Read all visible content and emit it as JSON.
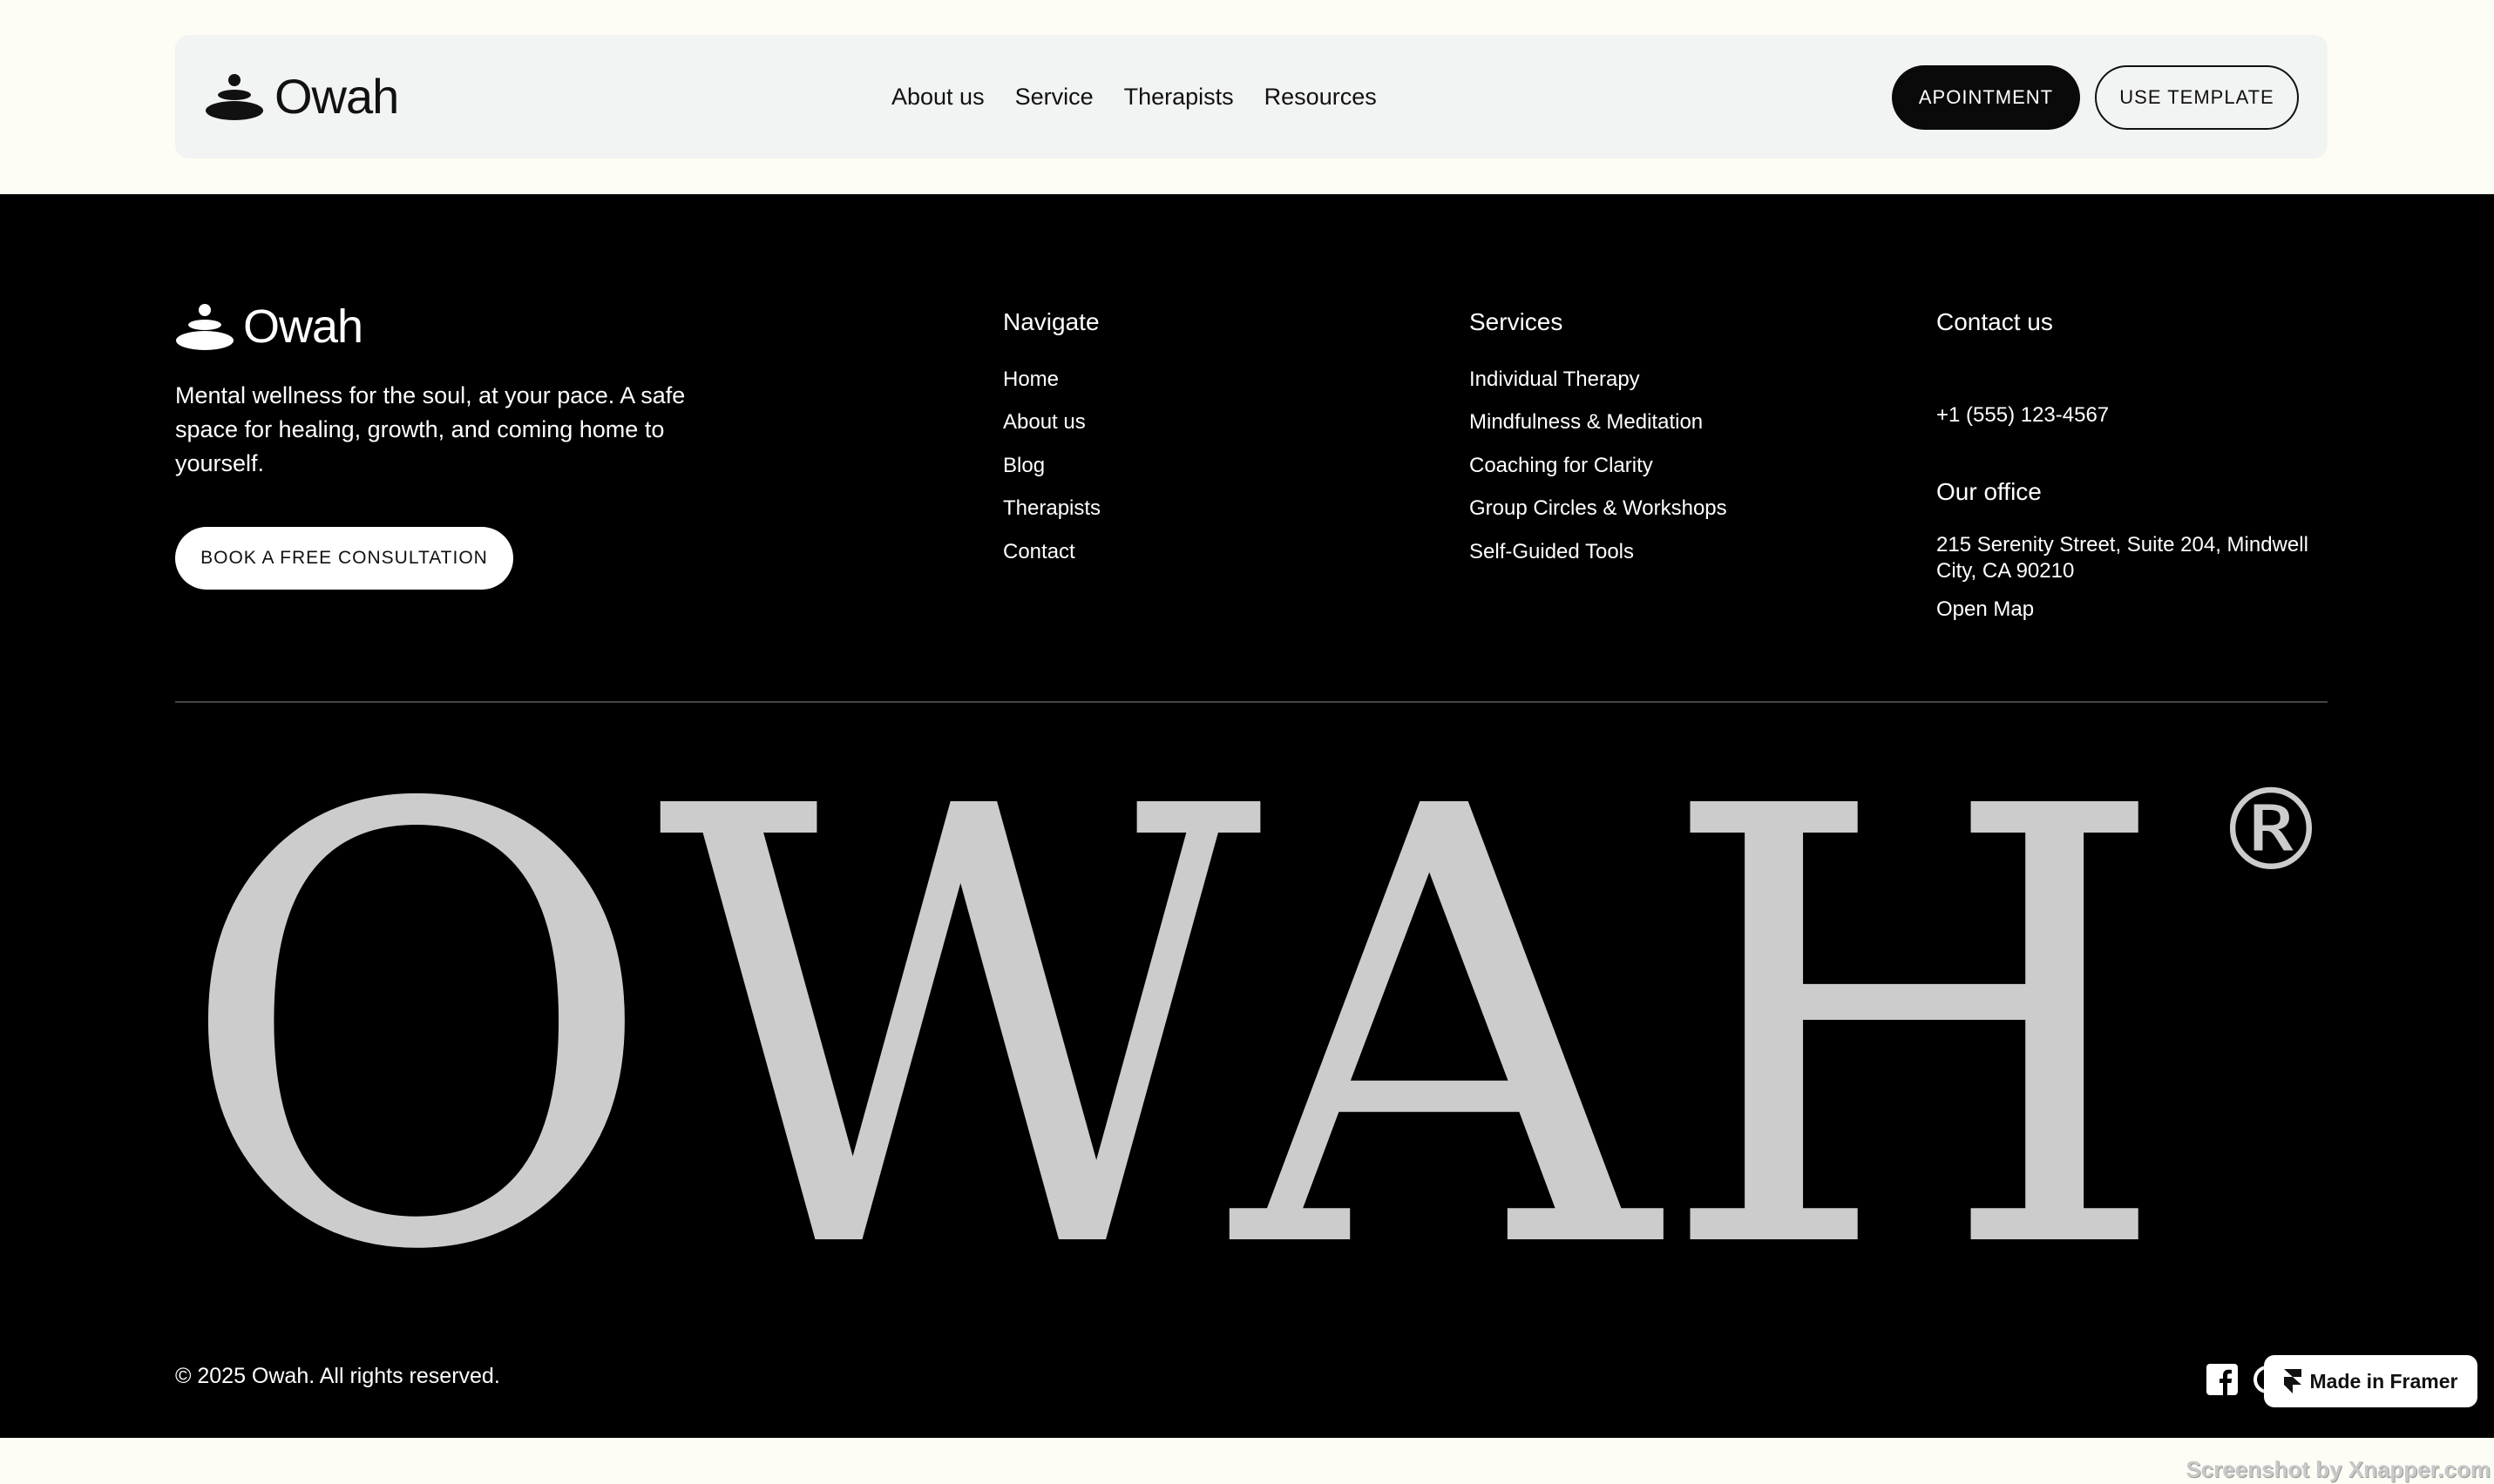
{
  "header": {
    "brand": "Owah",
    "nav": [
      "About us",
      "Service",
      "Therapists",
      "Resources"
    ],
    "appointment_label": "APOINTMENT",
    "template_label": "USE TEMPLATE"
  },
  "footer": {
    "brand": "Owah",
    "description": "Mental wellness for the soul, at your pace. A safe space for healing, growth, and coming home to yourself.",
    "consult_label": "BOOK A FREE CONSULTATION",
    "navigate": {
      "title": "Navigate",
      "items": [
        "Home",
        "About us",
        "Blog",
        "Therapists",
        "Contact"
      ]
    },
    "services": {
      "title": "Services",
      "items": [
        "Individual Therapy",
        "Mindfulness & Meditation",
        "Coaching for Clarity",
        "Group Circles & Workshops",
        "Self-Guided Tools"
      ]
    },
    "contact": {
      "title": "Contact us",
      "phone": "+1 (555) 123-4567",
      "office_title": "Our office",
      "office_address": "215 Serenity Street, Suite 204, Mindwell City, CA 90210",
      "map_label": "Open Map"
    },
    "wordmark": "OWAH",
    "registered": "®",
    "copyright": "© 2025 Owah. All rights reserved.",
    "framer_badge": "Made in Framer",
    "social_icons": [
      "facebook-icon",
      "instagram-icon"
    ]
  },
  "watermark": "Screenshot by Xnapper.com",
  "colors": {
    "page_bg": "#fdfdf5",
    "header_bg": "#f2f3f3",
    "footer_bg": "#000000",
    "wordmark": "#cccccc",
    "accent": "#0a0a0a"
  }
}
